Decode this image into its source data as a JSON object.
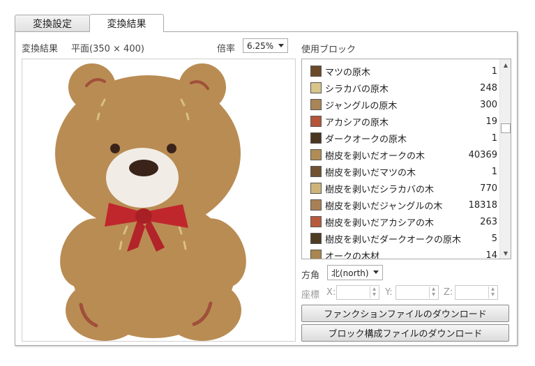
{
  "tabs": [
    {
      "label": "変換設定",
      "active": false
    },
    {
      "label": "変換結果",
      "active": true
    }
  ],
  "result": {
    "title": "変換結果",
    "plane_info": "平面(350 × 400)",
    "zoom_label": "倍率",
    "zoom_value": "6.25%"
  },
  "blocks": {
    "heading": "使用ブロック",
    "items": [
      {
        "name": "マツの原木",
        "count": "1",
        "color": "#6b4a2a",
        "icon": "spruce-log-icon"
      },
      {
        "name": "シラカバの原木",
        "count": "248",
        "color": "#d8c58a",
        "icon": "birch-log-icon"
      },
      {
        "name": "ジャングルの原木",
        "count": "300",
        "color": "#a98456",
        "icon": "jungle-log-icon"
      },
      {
        "name": "アカシアの原木",
        "count": "19",
        "color": "#b4553a",
        "icon": "acacia-log-icon"
      },
      {
        "name": "ダークオークの原木",
        "count": "1",
        "color": "#4a3520",
        "icon": "dark-oak-log-icon"
      },
      {
        "name": "樹皮を剥いだオークの木",
        "count": "40369",
        "color": "#b08d56",
        "icon": "stripped-oak-wood-icon"
      },
      {
        "name": "樹皮を剥いだマツの木",
        "count": "1",
        "color": "#6e5232",
        "icon": "stripped-spruce-wood-icon"
      },
      {
        "name": "樹皮を剥いだシラカバの木",
        "count": "770",
        "color": "#cdb57a",
        "icon": "stripped-birch-wood-icon"
      },
      {
        "name": "樹皮を剥いだジャングルの木",
        "count": "18318",
        "color": "#a88055",
        "icon": "stripped-jungle-wood-icon"
      },
      {
        "name": "樹皮を剥いだアカシアの木",
        "count": "263",
        "color": "#b85a3a",
        "icon": "stripped-acacia-wood-icon"
      },
      {
        "name": "樹皮を剥いだダークオークの原木",
        "count": "5",
        "color": "#4f3a22",
        "icon": "stripped-dark-oak-log-icon"
      },
      {
        "name": "オークの木材",
        "count": "14",
        "color": "#a9864f",
        "icon": "oak-planks-icon"
      }
    ]
  },
  "direction": {
    "label": "方角",
    "value": "北(north)"
  },
  "coords": {
    "label": "座標",
    "x_label": "X:",
    "y_label": "Y:",
    "z_label": "Z:"
  },
  "buttons": {
    "function_download": "ファンクションファイルのダウンロード",
    "structure_download": "ブロック構成ファイルのダウンロード"
  },
  "colors": {
    "bear_fur": "#b98c53",
    "bear_muzzle": "#f1ede6",
    "bow": "#c0272d",
    "bear_stitch": "#a0503a"
  }
}
